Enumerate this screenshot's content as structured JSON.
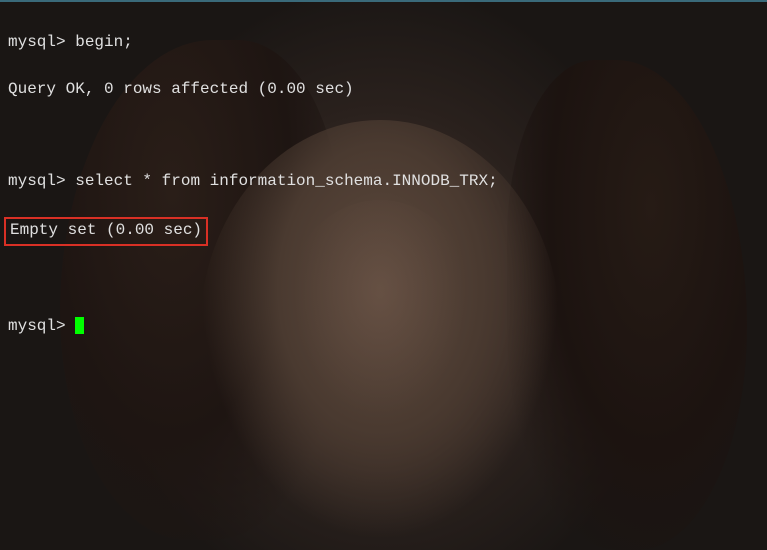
{
  "terminal": {
    "prompt": "mysql>",
    "lines": [
      {
        "type": "command",
        "prompt": "mysql>",
        "text": "begin;"
      },
      {
        "type": "output",
        "text": "Query OK, 0 rows affected (0.00 sec)"
      },
      {
        "type": "blank"
      },
      {
        "type": "command",
        "prompt": "mysql>",
        "text": "select * from information_schema.INNODB_TRX;"
      },
      {
        "type": "output-highlighted",
        "text": "Empty set (0.00 sec)"
      },
      {
        "type": "blank"
      },
      {
        "type": "prompt-cursor",
        "prompt": "mysql>"
      }
    ]
  }
}
